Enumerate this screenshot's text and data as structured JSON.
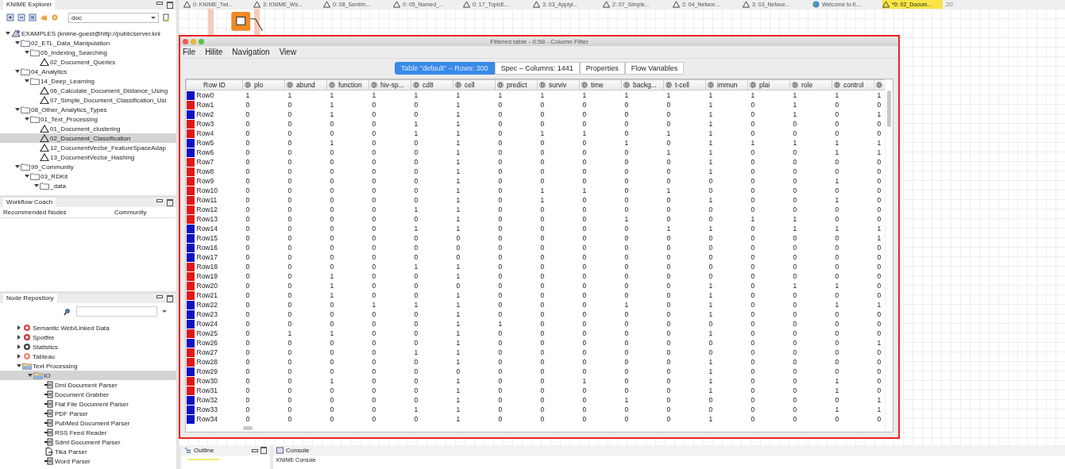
{
  "explorer": {
    "title": "KNIME Explorer",
    "mount_filter": "doc",
    "tree": [
      {
        "label": "EXAMPLES (knime-guest@http://publicserver.kni",
        "kind": "server",
        "expanded": true,
        "selected": false,
        "children": [
          {
            "label": "02_ETL_Data_Manipulation",
            "kind": "folder",
            "expanded": true,
            "selected": false,
            "children": [
              {
                "label": "05_Indexing_Searching",
                "kind": "folder",
                "expanded": true,
                "selected": false,
                "children": [
                  {
                    "label": "02_Document_Queries",
                    "kind": "workflow",
                    "selected": false
                  }
                ]
              }
            ]
          },
          {
            "label": "04_Analytics",
            "kind": "folder",
            "expanded": true,
            "selected": false,
            "children": [
              {
                "label": "14_Deep_Learning",
                "kind": "folder",
                "expanded": true,
                "selected": false,
                "children": [
                  {
                    "label": "06_Calculate_Document_Distance_Using",
                    "kind": "workflow",
                    "selected": false
                  },
                  {
                    "label": "07_Simple_Document_Classification_Usi",
                    "kind": "workflow",
                    "selected": false
                  }
                ]
              }
            ]
          },
          {
            "label": "08_Other_Analytics_Types",
            "kind": "folder",
            "expanded": true,
            "selected": false,
            "children": [
              {
                "label": "01_Text_Processing",
                "kind": "folder",
                "expanded": true,
                "selected": false,
                "children": [
                  {
                    "label": "01_Document_clustering",
                    "kind": "workflow",
                    "selected": false
                  },
                  {
                    "label": "02_Document_Classification",
                    "kind": "workflow",
                    "selected": true
                  },
                  {
                    "label": "12_DocumentVector_FeatureSpaceAdap",
                    "kind": "workflow",
                    "selected": false
                  },
                  {
                    "label": "13_DocumentVector_Hashing",
                    "kind": "workflow",
                    "selected": false
                  }
                ]
              }
            ]
          },
          {
            "label": "99_Community",
            "kind": "folder",
            "expanded": true,
            "selected": false,
            "children": [
              {
                "label": "03_RDKit",
                "kind": "folder",
                "expanded": true,
                "selected": false,
                "children": [
                  {
                    "label": "_data",
                    "kind": "folder",
                    "expanded": true,
                    "selected": false
                  }
                ]
              }
            ]
          }
        ]
      }
    ]
  },
  "coach": {
    "title": "Workflow Coach",
    "columns": [
      "Recommended Nodes",
      "Community"
    ]
  },
  "repository": {
    "title": "Node Repository",
    "tree": [
      {
        "label": "Semantic Web/Linked Data",
        "kind": "semantic",
        "expanded": false,
        "selected": false
      },
      {
        "label": "Spotfire",
        "kind": "spotfire",
        "expanded": false,
        "selected": false
      },
      {
        "label": "Statistics",
        "kind": "statistics",
        "expanded": false,
        "selected": false
      },
      {
        "label": "Tableau",
        "kind": "tableau",
        "expanded": false,
        "selected": false
      },
      {
        "label": "Text Processing",
        "kind": "openfolder",
        "expanded": true,
        "selected": false,
        "children": [
          {
            "label": "IO",
            "kind": "openfolder",
            "expanded": true,
            "selected": true,
            "children": [
              {
                "label": "Dml Document Parser",
                "kind": "node",
                "selected": false
              },
              {
                "label": "Document Grabber",
                "kind": "node",
                "selected": false
              },
              {
                "label": "Flat File Document Parser",
                "kind": "node",
                "selected": false
              },
              {
                "label": "PDF Parser",
                "kind": "node",
                "selected": false
              },
              {
                "label": "PubMed Document Parser",
                "kind": "node",
                "selected": false
              },
              {
                "label": "RSS Feed Reader",
                "kind": "node",
                "selected": false
              },
              {
                "label": "Sdml Document Parser",
                "kind": "node",
                "selected": false
              },
              {
                "label": "Tika Parser",
                "kind": "file",
                "selected": false
              },
              {
                "label": "Word Parser",
                "kind": "node",
                "selected": false
              }
            ]
          }
        ]
      }
    ]
  },
  "editor_tabs": [
    {
      "label": "0: KNIME_Twi...",
      "selected": false,
      "kind": "workflow"
    },
    {
      "label": "3: KNIME_Ws...",
      "selected": false,
      "kind": "workflow"
    },
    {
      "label": "0: 08_Sentim...",
      "selected": false,
      "kind": "workflow"
    },
    {
      "label": "0: 05_Named_...",
      "selected": false,
      "kind": "workflow"
    },
    {
      "label": "0: 17_TopicE...",
      "selected": false,
      "kind": "workflow"
    },
    {
      "label": "3: 03_Applyi...",
      "selected": false,
      "kind": "workflow"
    },
    {
      "label": "2: 07_Simple...",
      "selected": false,
      "kind": "workflow"
    },
    {
      "label": "2: 04_Networ...",
      "selected": false,
      "kind": "workflow"
    },
    {
      "label": "3: 03_Networ...",
      "selected": false,
      "kind": "workflow"
    },
    {
      "label": "Welcome to K...",
      "selected": false,
      "kind": "web"
    },
    {
      "label": "*0: 02_Docum...",
      "selected": true,
      "kind": "workflow"
    }
  ],
  "editor_overflow": "20",
  "dialog": {
    "title": "Filtered table - 0:58 - Column Filter",
    "menu": [
      "File",
      "Hilite",
      "Navigation",
      "View"
    ],
    "tabs": [
      {
        "label": "Table \"default\" – Rows: 300",
        "selected": true
      },
      {
        "label": "Spec – Columns: 1441",
        "selected": false
      },
      {
        "label": "Properties",
        "selected": false
      },
      {
        "label": "Flow Variables",
        "selected": false
      }
    ],
    "table": {
      "id_column": "Row ID",
      "columns": [
        "plo",
        "abund",
        "function",
        "hiv-sp...",
        "cd8",
        "cell",
        "predict",
        "surviv",
        "time",
        "backg...",
        "t-cell",
        "immun",
        "plai",
        "role",
        "control",
        null
      ],
      "rows": [
        {
          "id": "Row0",
          "color": "#1010c0",
          "values": [
            "1",
            "1",
            "1",
            "1",
            "1",
            "1",
            "1",
            "1",
            "1",
            "1",
            "1",
            "1",
            "1",
            "1",
            "1",
            "1"
          ]
        },
        {
          "id": "Row1",
          "color": "#e01818",
          "values": [
            "0",
            "0",
            "1",
            "0",
            "0",
            "1",
            "0",
            "0",
            "0",
            "0",
            "0",
            "1",
            "0",
            "1",
            "0",
            "0"
          ]
        },
        {
          "id": "Row2",
          "color": "#1010c0",
          "values": [
            "0",
            "0",
            "1",
            "0",
            "0",
            "1",
            "0",
            "0",
            "0",
            "0",
            "0",
            "1",
            "0",
            "1",
            "0",
            "1"
          ]
        },
        {
          "id": "Row3",
          "color": "#e01818",
          "values": [
            "0",
            "0",
            "0",
            "0",
            "1",
            "1",
            "0",
            "0",
            "0",
            "0",
            "0",
            "1",
            "0",
            "0",
            "0",
            "0"
          ]
        },
        {
          "id": "Row4",
          "color": "#e01818",
          "values": [
            "0",
            "0",
            "0",
            "0",
            "1",
            "1",
            "0",
            "1",
            "1",
            "0",
            "1",
            "1",
            "0",
            "0",
            "0",
            "0"
          ]
        },
        {
          "id": "Row5",
          "color": "#1010c0",
          "values": [
            "0",
            "0",
            "1",
            "0",
            "0",
            "1",
            "0",
            "0",
            "0",
            "1",
            "0",
            "1",
            "1",
            "1",
            "1",
            "1"
          ]
        },
        {
          "id": "Row6",
          "color": "#1010c0",
          "values": [
            "0",
            "0",
            "0",
            "0",
            "0",
            "1",
            "0",
            "0",
            "0",
            "0",
            "1",
            "1",
            "0",
            "0",
            "1",
            "1"
          ]
        },
        {
          "id": "Row7",
          "color": "#e01818",
          "values": [
            "0",
            "0",
            "0",
            "0",
            "0",
            "1",
            "0",
            "0",
            "0",
            "0",
            "0",
            "1",
            "0",
            "0",
            "0",
            "0"
          ]
        },
        {
          "id": "Row8",
          "color": "#e01818",
          "values": [
            "0",
            "0",
            "0",
            "0",
            "0",
            "1",
            "0",
            "0",
            "0",
            "0",
            "0",
            "1",
            "0",
            "0",
            "0",
            "0"
          ]
        },
        {
          "id": "Row9",
          "color": "#e01818",
          "values": [
            "0",
            "0",
            "0",
            "0",
            "0",
            "1",
            "0",
            "0",
            "0",
            "0",
            "0",
            "0",
            "0",
            "0",
            "1",
            "0"
          ]
        },
        {
          "id": "Row10",
          "color": "#e01818",
          "values": [
            "0",
            "0",
            "0",
            "0",
            "0",
            "1",
            "0",
            "1",
            "1",
            "0",
            "1",
            "0",
            "0",
            "0",
            "0",
            "0"
          ]
        },
        {
          "id": "Row11",
          "color": "#e01818",
          "values": [
            "0",
            "0",
            "0",
            "0",
            "0",
            "1",
            "0",
            "1",
            "0",
            "0",
            "0",
            "1",
            "0",
            "0",
            "1",
            "0"
          ]
        },
        {
          "id": "Row12",
          "color": "#e01818",
          "values": [
            "0",
            "0",
            "0",
            "0",
            "1",
            "1",
            "0",
            "0",
            "0",
            "0",
            "0",
            "0",
            "0",
            "0",
            "0",
            "0"
          ]
        },
        {
          "id": "Row13",
          "color": "#e01818",
          "values": [
            "0",
            "0",
            "0",
            "0",
            "0",
            "1",
            "0",
            "0",
            "0",
            "1",
            "0",
            "0",
            "1",
            "1",
            "0",
            "0"
          ]
        },
        {
          "id": "Row14",
          "color": "#1010c0",
          "values": [
            "0",
            "0",
            "0",
            "0",
            "1",
            "1",
            "0",
            "0",
            "0",
            "0",
            "1",
            "1",
            "0",
            "1",
            "1",
            "1"
          ]
        },
        {
          "id": "Row15",
          "color": "#1010c0",
          "values": [
            "0",
            "0",
            "0",
            "0",
            "0",
            "0",
            "0",
            "0",
            "0",
            "0",
            "0",
            "0",
            "0",
            "0",
            "0",
            "1"
          ]
        },
        {
          "id": "Row16",
          "color": "#1010c0",
          "values": [
            "0",
            "0",
            "0",
            "0",
            "0",
            "0",
            "0",
            "0",
            "0",
            "0",
            "0",
            "0",
            "0",
            "0",
            "0",
            "0"
          ]
        },
        {
          "id": "Row17",
          "color": "#1010c0",
          "values": [
            "0",
            "0",
            "0",
            "0",
            "0",
            "0",
            "0",
            "0",
            "0",
            "0",
            "0",
            "0",
            "0",
            "0",
            "0",
            "0"
          ]
        },
        {
          "id": "Row18",
          "color": "#e01818",
          "values": [
            "0",
            "0",
            "0",
            "0",
            "1",
            "1",
            "0",
            "0",
            "0",
            "0",
            "0",
            "0",
            "0",
            "0",
            "0",
            "0"
          ]
        },
        {
          "id": "Row19",
          "color": "#e01818",
          "values": [
            "0",
            "0",
            "1",
            "0",
            "0",
            "1",
            "0",
            "0",
            "0",
            "0",
            "0",
            "0",
            "0",
            "0",
            "0",
            "0"
          ]
        },
        {
          "id": "Row20",
          "color": "#e01818",
          "values": [
            "0",
            "0",
            "1",
            "0",
            "0",
            "0",
            "0",
            "0",
            "0",
            "0",
            "0",
            "1",
            "0",
            "1",
            "1",
            "0"
          ]
        },
        {
          "id": "Row21",
          "color": "#e01818",
          "values": [
            "0",
            "0",
            "1",
            "0",
            "0",
            "1",
            "0",
            "0",
            "0",
            "0",
            "0",
            "1",
            "0",
            "0",
            "0",
            "0"
          ]
        },
        {
          "id": "Row22",
          "color": "#1010c0",
          "values": [
            "0",
            "0",
            "0",
            "1",
            "1",
            "1",
            "0",
            "0",
            "0",
            "1",
            "0",
            "1",
            "0",
            "0",
            "1",
            "1"
          ]
        },
        {
          "id": "Row23",
          "color": "#1010c0",
          "values": [
            "0",
            "0",
            "0",
            "0",
            "0",
            "1",
            "0",
            "0",
            "0",
            "0",
            "0",
            "1",
            "0",
            "0",
            "0",
            "0"
          ]
        },
        {
          "id": "Row24",
          "color": "#1010c0",
          "values": [
            "0",
            "0",
            "0",
            "0",
            "0",
            "1",
            "1",
            "0",
            "0",
            "0",
            "0",
            "0",
            "0",
            "0",
            "0",
            "0"
          ]
        },
        {
          "id": "Row25",
          "color": "#e01818",
          "values": [
            "0",
            "1",
            "1",
            "0",
            "0",
            "1",
            "0",
            "0",
            "0",
            "0",
            "0",
            "1",
            "0",
            "0",
            "0",
            "0"
          ]
        },
        {
          "id": "Row26",
          "color": "#1010c0",
          "values": [
            "0",
            "0",
            "0",
            "0",
            "0",
            "1",
            "0",
            "0",
            "0",
            "0",
            "0",
            "0",
            "0",
            "0",
            "0",
            "1"
          ]
        },
        {
          "id": "Row27",
          "color": "#e01818",
          "values": [
            "0",
            "0",
            "0",
            "0",
            "1",
            "1",
            "0",
            "0",
            "0",
            "0",
            "0",
            "0",
            "0",
            "0",
            "0",
            "0"
          ]
        },
        {
          "id": "Row28",
          "color": "#e01818",
          "values": [
            "0",
            "0",
            "0",
            "0",
            "0",
            "1",
            "0",
            "0",
            "0",
            "0",
            "0",
            "1",
            "0",
            "0",
            "0",
            "0"
          ]
        },
        {
          "id": "Row29",
          "color": "#1010c0",
          "values": [
            "0",
            "0",
            "0",
            "0",
            "0",
            "0",
            "0",
            "0",
            "0",
            "0",
            "0",
            "1",
            "0",
            "0",
            "0",
            "0"
          ]
        },
        {
          "id": "Row30",
          "color": "#e01818",
          "values": [
            "0",
            "0",
            "1",
            "0",
            "0",
            "1",
            "0",
            "0",
            "1",
            "0",
            "0",
            "1",
            "0",
            "0",
            "1",
            "0"
          ]
        },
        {
          "id": "Row31",
          "color": "#e01818",
          "values": [
            "0",
            "0",
            "0",
            "0",
            "0",
            "1",
            "0",
            "0",
            "0",
            "0",
            "0",
            "1",
            "0",
            "0",
            "1",
            "0"
          ]
        },
        {
          "id": "Row32",
          "color": "#1010c0",
          "values": [
            "0",
            "0",
            "0",
            "0",
            "0",
            "1",
            "0",
            "0",
            "0",
            "1",
            "0",
            "0",
            "0",
            "0",
            "0",
            "1"
          ]
        },
        {
          "id": "Row33",
          "color": "#1010c0",
          "values": [
            "0",
            "0",
            "0",
            "0",
            "1",
            "1",
            "0",
            "0",
            "0",
            "0",
            "0",
            "0",
            "0",
            "0",
            "1",
            "1"
          ]
        },
        {
          "id": "Row34",
          "color": "#1010c0",
          "values": [
            "0",
            "0",
            "0",
            "0",
            "0",
            "1",
            "0",
            "0",
            "0",
            "0",
            "0",
            "1",
            "0",
            "0",
            "0",
            "0"
          ]
        }
      ]
    }
  },
  "bottom_tabs": [
    {
      "title": "Outline",
      "kind": "outline"
    },
    {
      "title": "Console",
      "kind": "console",
      "content": "KNIME Console"
    }
  ]
}
